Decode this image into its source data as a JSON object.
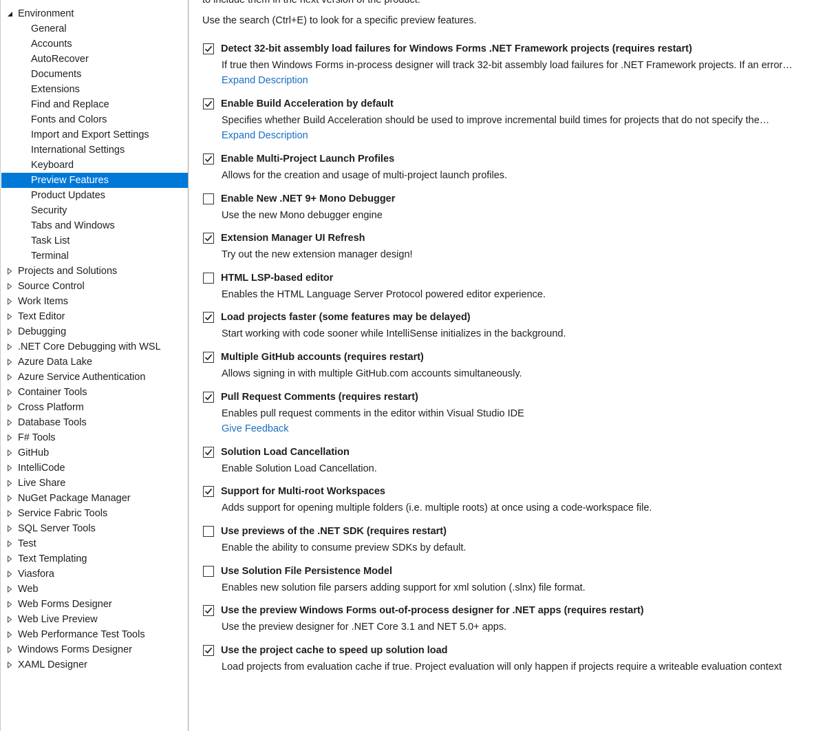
{
  "tree": {
    "items": [
      {
        "label": "Environment",
        "level": 0,
        "expanded": true
      },
      {
        "label": "General",
        "level": 1
      },
      {
        "label": "Accounts",
        "level": 1
      },
      {
        "label": "AutoRecover",
        "level": 1
      },
      {
        "label": "Documents",
        "level": 1
      },
      {
        "label": "Extensions",
        "level": 1
      },
      {
        "label": "Find and Replace",
        "level": 1
      },
      {
        "label": "Fonts and Colors",
        "level": 1
      },
      {
        "label": "Import and Export Settings",
        "level": 1
      },
      {
        "label": "International Settings",
        "level": 1
      },
      {
        "label": "Keyboard",
        "level": 1
      },
      {
        "label": "Preview Features",
        "level": 1,
        "selected": true
      },
      {
        "label": "Product Updates",
        "level": 1
      },
      {
        "label": "Security",
        "level": 1
      },
      {
        "label": "Tabs and Windows",
        "level": 1
      },
      {
        "label": "Task List",
        "level": 1
      },
      {
        "label": "Terminal",
        "level": 1
      },
      {
        "label": "Projects and Solutions",
        "level": 0,
        "expanded": false
      },
      {
        "label": "Source Control",
        "level": 0,
        "expanded": false
      },
      {
        "label": "Work Items",
        "level": 0,
        "expanded": false
      },
      {
        "label": "Text Editor",
        "level": 0,
        "expanded": false
      },
      {
        "label": "Debugging",
        "level": 0,
        "expanded": false
      },
      {
        "label": ".NET Core Debugging with WSL",
        "level": 0,
        "expanded": false
      },
      {
        "label": "Azure Data Lake",
        "level": 0,
        "expanded": false
      },
      {
        "label": "Azure Service Authentication",
        "level": 0,
        "expanded": false
      },
      {
        "label": "Container Tools",
        "level": 0,
        "expanded": false
      },
      {
        "label": "Cross Platform",
        "level": 0,
        "expanded": false
      },
      {
        "label": "Database Tools",
        "level": 0,
        "expanded": false
      },
      {
        "label": "F# Tools",
        "level": 0,
        "expanded": false
      },
      {
        "label": "GitHub",
        "level": 0,
        "expanded": false
      },
      {
        "label": "IntelliCode",
        "level": 0,
        "expanded": false
      },
      {
        "label": "Live Share",
        "level": 0,
        "expanded": false
      },
      {
        "label": "NuGet Package Manager",
        "level": 0,
        "expanded": false
      },
      {
        "label": "Service Fabric Tools",
        "level": 0,
        "expanded": false
      },
      {
        "label": "SQL Server Tools",
        "level": 0,
        "expanded": false
      },
      {
        "label": "Test",
        "level": 0,
        "expanded": false
      },
      {
        "label": "Text Templating",
        "level": 0,
        "expanded": false
      },
      {
        "label": "Viasfora",
        "level": 0,
        "expanded": false
      },
      {
        "label": "Web",
        "level": 0,
        "expanded": false
      },
      {
        "label": "Web Forms Designer",
        "level": 0,
        "expanded": false
      },
      {
        "label": "Web Live Preview",
        "level": 0,
        "expanded": false
      },
      {
        "label": "Web Performance Test Tools",
        "level": 0,
        "expanded": false
      },
      {
        "label": "Windows Forms Designer",
        "level": 0,
        "expanded": false
      },
      {
        "label": "XAML Designer",
        "level": 0,
        "expanded": false
      }
    ]
  },
  "intro": {
    "partial_line": "to include them in the next version of the product.",
    "search_hint": "Use the search (Ctrl+E) to look for a specific preview features."
  },
  "features": [
    {
      "title": "Detect 32-bit assembly load failures for Windows Forms .NET Framework projects (requires restart)",
      "checked": true,
      "description": "If true then Windows Forms in-process designer will track 32-bit assembly load failures for .NET Framework projects. If an error…",
      "link": "Expand Description"
    },
    {
      "title": "Enable Build Acceleration by default",
      "checked": true,
      "description": "Specifies whether Build Acceleration should be used to improve incremental build times for projects that do not specify the…",
      "link": "Expand Description"
    },
    {
      "title": "Enable Multi-Project Launch Profiles",
      "checked": true,
      "description": "Allows for the creation and usage of multi-project launch profiles."
    },
    {
      "title": "Enable New .NET 9+ Mono Debugger",
      "checked": false,
      "description": "Use the new Mono debugger engine"
    },
    {
      "title": "Extension Manager UI Refresh",
      "checked": true,
      "description": "Try out the new extension manager design!"
    },
    {
      "title": "HTML LSP-based editor",
      "checked": false,
      "description": "Enables the HTML Language Server Protocol powered editor experience."
    },
    {
      "title": "Load projects faster (some features may be delayed)",
      "checked": true,
      "description": "Start working with code sooner while IntelliSense initializes in the background."
    },
    {
      "title": "Multiple GitHub accounts (requires restart)",
      "checked": true,
      "description": "Allows signing in with multiple GitHub.com accounts simultaneously."
    },
    {
      "title": "Pull Request Comments (requires restart)",
      "checked": true,
      "description": "Enables pull request comments in the editor within Visual Studio IDE",
      "link": "Give Feedback"
    },
    {
      "title": "Solution Load Cancellation",
      "checked": true,
      "description": "Enable Solution Load Cancellation."
    },
    {
      "title": "Support for Multi-root Workspaces",
      "checked": true,
      "description": "Adds support for opening multiple folders (i.e. multiple roots) at once using a code-workspace file."
    },
    {
      "title": "Use previews of the .NET SDK (requires restart)",
      "checked": false,
      "description": "Enable the ability to consume preview SDKs by default."
    },
    {
      "title": "Use Solution File Persistence Model",
      "checked": false,
      "description": "Enables new solution file parsers adding support for xml solution (.slnx) file format."
    },
    {
      "title": "Use the preview Windows Forms out-of-process designer for .NET apps (requires restart)",
      "checked": true,
      "description": "Use the preview designer for .NET Core 3.1 and NET 5.0+ apps."
    },
    {
      "title": "Use the project cache to speed up solution load",
      "checked": true,
      "description": "Load projects from evaluation cache if true. Project evaluation will only happen if projects require a writeable evaluation context"
    }
  ],
  "colors": {
    "selection": "#0078d7",
    "link": "#1a6fc2",
    "border": "#a0a0a0"
  }
}
